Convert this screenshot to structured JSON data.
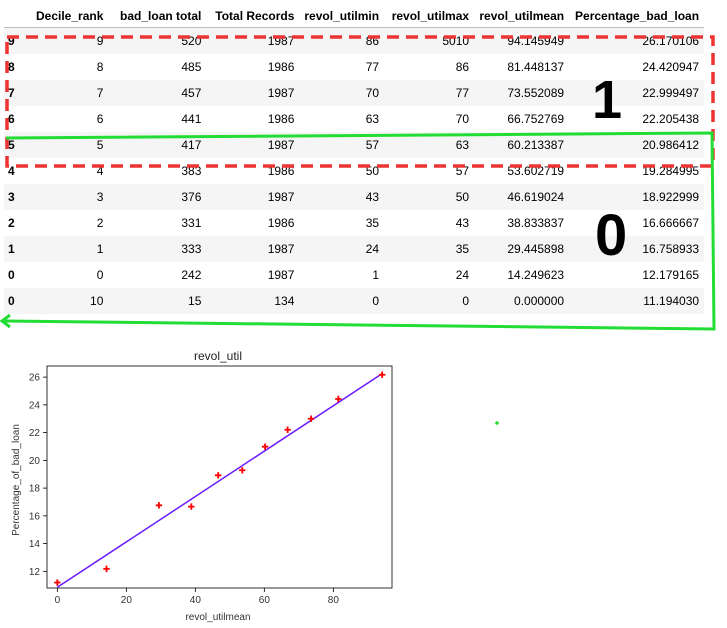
{
  "table": {
    "columns": [
      "",
      "Decile_rank",
      "bad_loan total",
      "Total Records",
      "revol_utilmin",
      "revol_utilmax",
      "revol_utilmean",
      "Percentage_bad_loan"
    ],
    "rows": [
      [
        "9",
        "9",
        "520",
        "1987",
        "86",
        "5010",
        "94.145949",
        "26.170106"
      ],
      [
        "8",
        "8",
        "485",
        "1986",
        "77",
        "86",
        "81.448137",
        "24.420947"
      ],
      [
        "7",
        "7",
        "457",
        "1987",
        "70",
        "77",
        "73.552089",
        "22.999497"
      ],
      [
        "6",
        "6",
        "441",
        "1986",
        "63",
        "70",
        "66.752769",
        "22.205438"
      ],
      [
        "5",
        "5",
        "417",
        "1987",
        "57",
        "63",
        "60.213387",
        "20.986412"
      ],
      [
        "4",
        "4",
        "383",
        "1986",
        "50",
        "57",
        "53.602719",
        "19.284995"
      ],
      [
        "3",
        "3",
        "376",
        "1987",
        "43",
        "50",
        "46.619024",
        "18.922999"
      ],
      [
        "2",
        "2",
        "331",
        "1986",
        "35",
        "43",
        "38.833837",
        "16.666667"
      ],
      [
        "1",
        "1",
        "333",
        "1987",
        "24",
        "35",
        "29.445898",
        "16.758933"
      ],
      [
        "0",
        "0",
        "242",
        "1987",
        "1",
        "24",
        "14.249623",
        "12.179165"
      ],
      [
        "0",
        "10",
        "15",
        "134",
        "0",
        "0",
        "0.000000",
        "11.194030"
      ]
    ]
  },
  "annotations": {
    "group_1_label": "1",
    "group_0_label": "0",
    "red_color": "#ee3333",
    "green_color": "#22dd33"
  },
  "chart_data": {
    "type": "scatter",
    "title": "revol_util",
    "xlabel": "revol_utilmean",
    "ylabel": "Percentage_of_bad_loan",
    "xlim": [
      -3,
      97
    ],
    "ylim": [
      10.8,
      26.8
    ],
    "xticks": [
      0,
      20,
      40,
      60,
      80
    ],
    "yticks": [
      12,
      14,
      16,
      18,
      20,
      22,
      24,
      26
    ],
    "points": {
      "x": [
        94.145949,
        81.448137,
        73.552089,
        66.752769,
        60.213387,
        53.602719,
        46.619024,
        38.833837,
        29.445898,
        14.249623,
        0.0
      ],
      "y": [
        26.170106,
        24.420947,
        22.999497,
        22.205438,
        20.986412,
        19.284995,
        18.922999,
        16.666667,
        16.758933,
        12.179165,
        11.19403
      ]
    },
    "marker": "plus",
    "marker_color": "#ff0000",
    "fit_line": {
      "x": [
        0,
        94.145949
      ],
      "y": [
        10.85,
        26.25
      ],
      "color": "#6a1bff"
    }
  }
}
